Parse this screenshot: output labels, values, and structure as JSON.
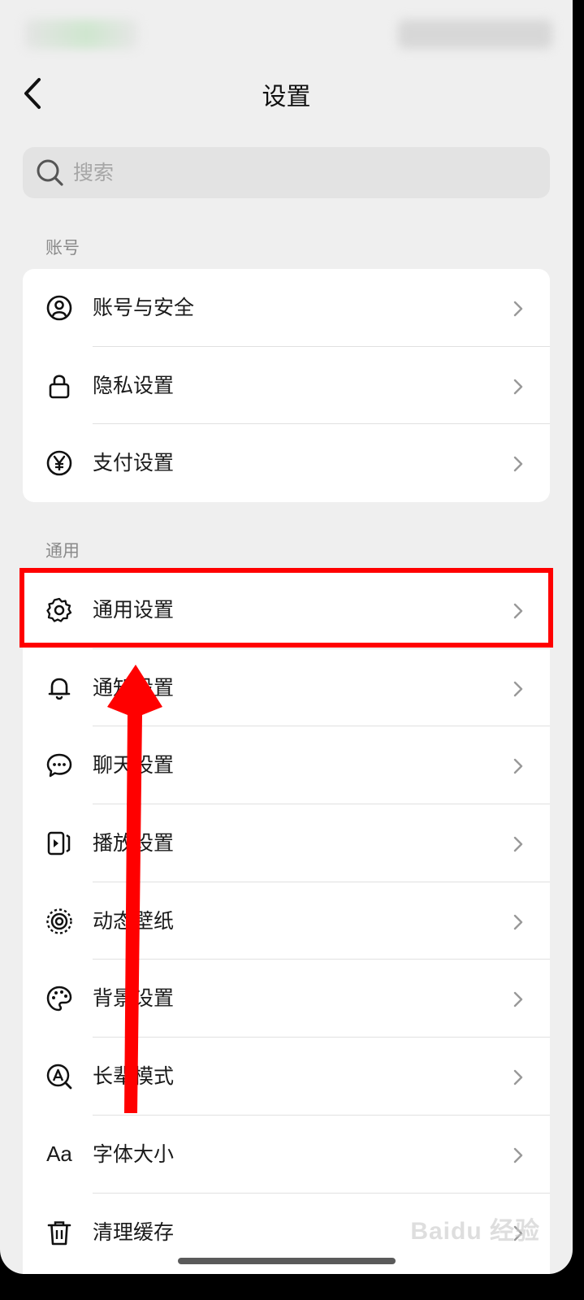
{
  "nav": {
    "title": "设置"
  },
  "search": {
    "placeholder": "搜索"
  },
  "sections": [
    {
      "header": "账号",
      "items": [
        {
          "label": "账号与安全",
          "icon": "user-circle-icon"
        },
        {
          "label": "隐私设置",
          "icon": "lock-icon"
        },
        {
          "label": "支付设置",
          "icon": "yen-circle-icon"
        }
      ]
    },
    {
      "header": "通用",
      "items": [
        {
          "label": "通用设置",
          "icon": "gear-icon",
          "highlighted": true
        },
        {
          "label": "通知设置",
          "icon": "bell-icon"
        },
        {
          "label": "聊天设置",
          "icon": "chat-bubble-icon"
        },
        {
          "label": "播放设置",
          "icon": "play-card-icon"
        },
        {
          "label": "动态壁纸",
          "icon": "dynamic-wallpaper-icon"
        },
        {
          "label": "背景设置",
          "icon": "palette-icon"
        },
        {
          "label": "长辈模式",
          "icon": "elder-mode-icon"
        },
        {
          "label": "字体大小",
          "icon": "font-size-icon",
          "glyph": "Aa"
        },
        {
          "label": "清理缓存",
          "icon": "trash-icon"
        }
      ]
    }
  ],
  "annotation": {
    "highlight_color": "#ff0000"
  },
  "watermark": "Baidu 经验"
}
